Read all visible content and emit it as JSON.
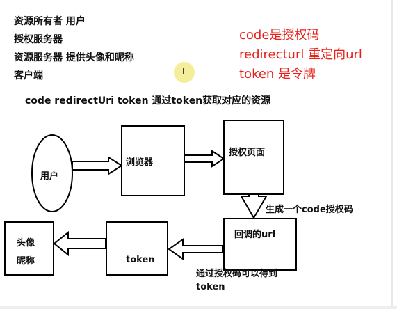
{
  "notes": {
    "line1": "资源所有者 用户",
    "line2": "授权服务器",
    "line3": "资源服务器 提供头像和昵称",
    "line4": "客户端",
    "summary": "code  redirectUri token 通过token获取对应的资源"
  },
  "legend": {
    "code": "code是授权码",
    "redirect": "redirecturl 重定向url",
    "token": "token 是令牌"
  },
  "nodes": {
    "user": "用户",
    "browser": "浏览器",
    "auth_page": "授权页面",
    "callback": "回调的url",
    "token": "token",
    "avatar_line1": "头像",
    "avatar_line2": "昵称"
  },
  "edges": {
    "generate_code": "生成一个code授权码",
    "via_code_line1": "通过授权码可以得到",
    "via_code_line2": "token"
  },
  "colors": {
    "legend_red": "#e8201a",
    "stroke": "#000000",
    "cursor_highlight": "#f0e878"
  }
}
